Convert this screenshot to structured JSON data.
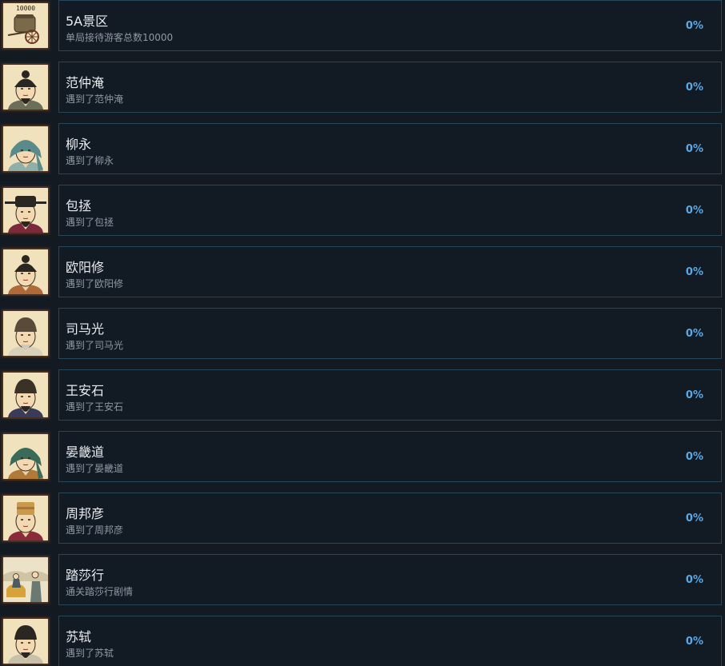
{
  "achievements": [
    {
      "title": "5A景区",
      "desc": "单局接待游客总数10000",
      "percent": "0%",
      "icon": "cart-icon",
      "badge": "10000"
    },
    {
      "title": "范仲淹",
      "desc": "遇到了范仲淹",
      "percent": "0%",
      "icon": "portrait-fan-zhongyan-icon"
    },
    {
      "title": "柳永",
      "desc": "遇到了柳永",
      "percent": "0%",
      "icon": "portrait-liu-yong-icon"
    },
    {
      "title": "包拯",
      "desc": "遇到了包拯",
      "percent": "0%",
      "icon": "portrait-bao-zheng-icon"
    },
    {
      "title": "欧阳修",
      "desc": "遇到了欧阳修",
      "percent": "0%",
      "icon": "portrait-ouyang-xiu-icon"
    },
    {
      "title": "司马光",
      "desc": "遇到了司马光",
      "percent": "0%",
      "icon": "portrait-sima-guang-icon"
    },
    {
      "title": "王安石",
      "desc": "遇到了王安石",
      "percent": "0%",
      "icon": "portrait-wang-anshi-icon"
    },
    {
      "title": "晏畿道",
      "desc": "遇到了晏畿道",
      "percent": "0%",
      "icon": "portrait-yan-jidao-icon"
    },
    {
      "title": "周邦彦",
      "desc": "遇到了周邦彦",
      "percent": "0%",
      "icon": "portrait-zhou-bangyan-icon"
    },
    {
      "title": "踏莎行",
      "desc": "通关踏莎行剧情",
      "percent": "0%",
      "icon": "scene-tasha-xing-icon"
    },
    {
      "title": "苏轼",
      "desc": "遇到了苏轼",
      "percent": "0%",
      "icon": "portrait-su-shi-icon"
    }
  ],
  "colors": {
    "background": "#141a22",
    "card_border": "#26465a",
    "percent": "#5aa9e6",
    "title": "#e8ecef",
    "desc": "#8f98a3"
  }
}
